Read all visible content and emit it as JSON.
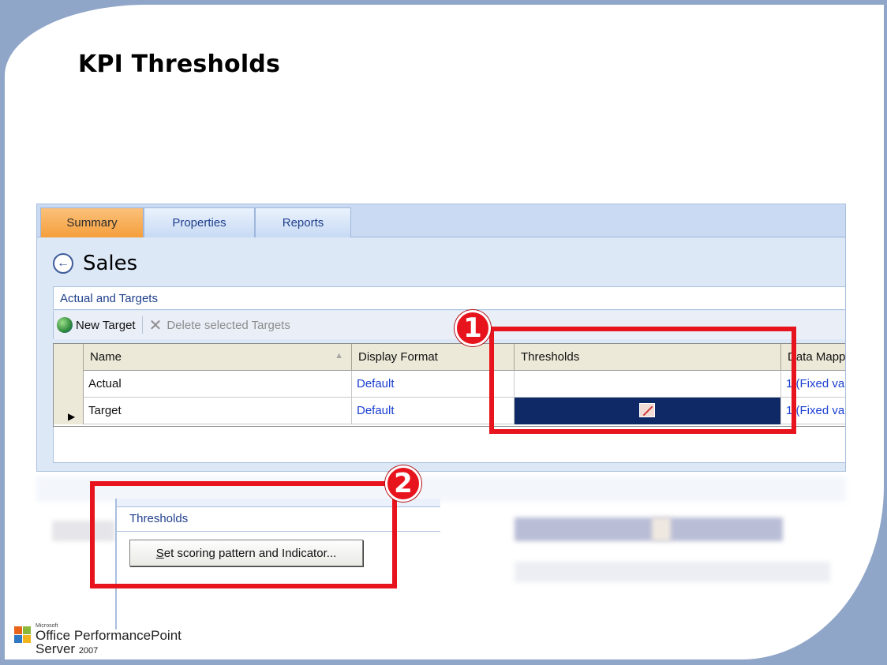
{
  "slide": {
    "title": "KPI Thresholds"
  },
  "tabs": [
    {
      "label": "Summary",
      "active": true
    },
    {
      "label": "Properties",
      "active": false
    },
    {
      "label": "Reports",
      "active": false
    }
  ],
  "page": {
    "title": "Sales"
  },
  "section": {
    "title": "Actual and Targets"
  },
  "toolbar": {
    "new_target": "New Target",
    "delete_targets": "Delete selected Targets"
  },
  "grid": {
    "columns": [
      "Name",
      "Display Format",
      "Thresholds",
      "Data Mapp"
    ],
    "rows": [
      {
        "name": "Actual",
        "display_format": "Default",
        "thresholds": "",
        "data_mapping": "1 (Fixed va"
      },
      {
        "name": "Target",
        "display_format": "Default",
        "thresholds": "",
        "data_mapping": "1 (Fixed va",
        "selected": true
      }
    ]
  },
  "callouts": {
    "one": "1",
    "two": "2"
  },
  "thresholds_panel": {
    "title": "Thresholds",
    "button_underlined": "S",
    "button_rest": "et scoring pattern and Indicator..."
  },
  "logo": {
    "microsoft": "Microsoft",
    "office": "Office PerformancePoint",
    "server": "Server",
    "year": "2007"
  },
  "colors": {
    "callout_red": "#e8141d",
    "tab_active": "#f59e3c",
    "link_blue": "#1a3fd0",
    "selected_cell": "#0f2966"
  }
}
